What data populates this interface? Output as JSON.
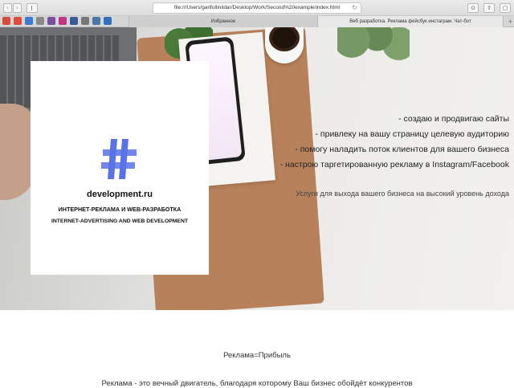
{
  "browser": {
    "url": "file:///Users/garifullinildar/Desktop/Work/Second%20example/index.html",
    "reload_icon": "↻",
    "tabs": [
      {
        "label": "Избранное"
      },
      {
        "label": "Веб разработка. Реклама фейсбук инстаграм. Чат-бот"
      }
    ],
    "new_tab": "+",
    "favorites": [
      {
        "icon": "mail-icon",
        "color": "#d94b3a"
      },
      {
        "icon": "gmail-icon",
        "color": "#e04a3b"
      },
      {
        "icon": "chrome-icon",
        "color": "#3b7bd8"
      },
      {
        "icon": "globe-icon",
        "color": "#8a8a8a"
      },
      {
        "icon": "tor-icon",
        "color": "#7b4fa0"
      },
      {
        "icon": "instagram-icon",
        "color": "#c13584"
      },
      {
        "icon": "facebook-icon",
        "color": "#3b5998"
      },
      {
        "icon": "image-icon",
        "color": "#777777"
      },
      {
        "icon": "vk-icon",
        "color": "#4a76a8"
      },
      {
        "icon": "mail-ru-icon",
        "color": "#2f6fbd"
      }
    ]
  },
  "hero": {
    "brand": "development.ru",
    "tagline_ru": "ИНТЕРНЕТ-РЕКЛАМА И WEB-РАЗРАБОТКА",
    "tagline_en": "INTERNET-ADVERTISING AND WEB DEVELOPMENT",
    "logo_color": "#5a72e8",
    "services": [
      "- создаю и продвигаю сайты",
      "- привлеку на вашу страницу целевую аудиторию",
      "- помогу наладить поток клиентов для вашего бизнеса",
      "- настрою таргетированную рекламу в Instagram/Facebook"
    ],
    "subtitle": "Услуги для выхода вашего бизнеса на высокий уровень дохода"
  },
  "section": {
    "title": "Реклама=Прибыль",
    "body": "Реклама - это вечный двигатель, благодаря которому Ваш бизнес обойдёт конкурентов"
  }
}
